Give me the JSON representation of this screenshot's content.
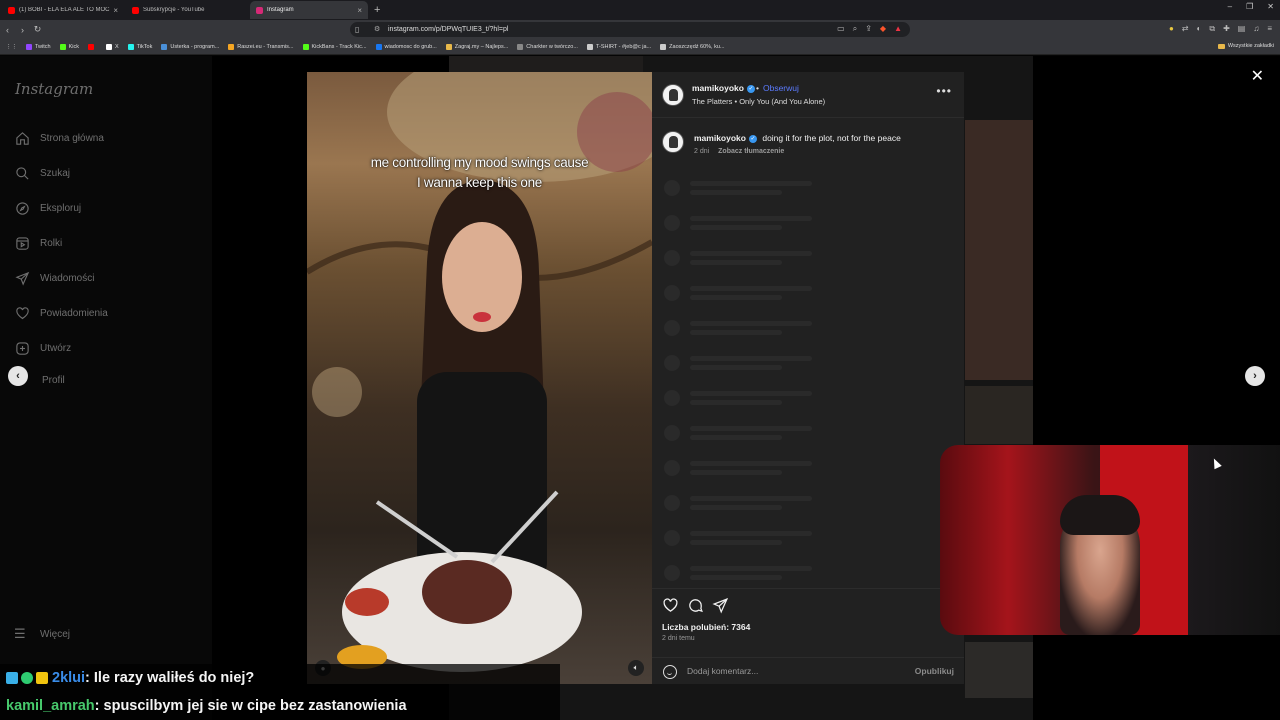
{
  "browser": {
    "tabs": [
      {
        "title": "(1) BOBI - ELA ELA ALE TO MOCNA",
        "color": "#ff0000"
      },
      {
        "title": "Subskrypcje - YouTube",
        "color": "#ff0000"
      },
      {
        "title": "Instagram",
        "color": "#d62976"
      }
    ],
    "new_tab": "+",
    "url": "instagram.com/p/DPWqTUIE3_t/?hl=pl",
    "bookmarks": [
      {
        "label": "Twitch",
        "color": "#9146ff"
      },
      {
        "label": "Kick",
        "color": "#53fc18"
      },
      {
        "label": "",
        "color": "#ff0000"
      },
      {
        "label": "X",
        "color": "#ffffff"
      },
      {
        "label": "TikTok",
        "color": "#25f4ee"
      },
      {
        "label": "Usterka - program...",
        "color": "#4a90d9"
      },
      {
        "label": "Raszei.eu - Transmis...",
        "color": "#f5a623"
      },
      {
        "label": "KickBans - Track Kic...",
        "color": "#53fc18"
      },
      {
        "label": "wiadomosc do grub...",
        "color": "#1877f2"
      },
      {
        "label": "Zagraj.my – Najleps...",
        "color": "#e8b84a"
      },
      {
        "label": "Charkter w twórczo...",
        "color": "#888888"
      },
      {
        "label": "T-SHIRT - #jeb@c ja...",
        "color": "#cccccc"
      },
      {
        "label": "Zaoszczędź 60%, ku...",
        "color": "#cccccc"
      }
    ],
    "bookmarks_all": "Wszystkie zakładki"
  },
  "sidebar": {
    "logo": "Instagram",
    "items": [
      {
        "label": "Strona główna",
        "icon": "home-icon"
      },
      {
        "label": "Szukaj",
        "icon": "search-icon"
      },
      {
        "label": "Eksploruj",
        "icon": "explore-icon"
      },
      {
        "label": "Rolki",
        "icon": "reels-icon"
      },
      {
        "label": "Wiadomości",
        "icon": "messages-icon"
      },
      {
        "label": "Powiadomienia",
        "icon": "heart-icon"
      },
      {
        "label": "Utwórz",
        "icon": "create-icon"
      },
      {
        "label": "Profil",
        "icon": "profile-icon"
      }
    ],
    "more": "Więcej"
  },
  "post": {
    "overlay_caption_line1": "me controlling my mood swings cause",
    "overlay_caption_line2": "I wanna keep this one",
    "username": "mamikoyoko",
    "follow": "Obserwuj",
    "dot": "•",
    "music": "The Platters • Only You (And You Alone)",
    "caption": "doing it for the plot, not for the peace",
    "caption_age": "2 dni",
    "translate": "Zobacz tłumaczenie",
    "likes": "Liczba polubień: 7364",
    "posted": "2 dni temu",
    "comment_placeholder": "Dodaj komentarz...",
    "publish": "Opublikuj",
    "more": "•••"
  },
  "chat": [
    {
      "user": "2klui",
      "message": ": Ile razy waliłeś do niej?"
    },
    {
      "user": "kamil_amrah",
      "message": ": spuscilbym jej sie w cipe bez zastanowienia"
    }
  ],
  "colors": {
    "accent": "#5b7bff",
    "verified": "#3897f0"
  }
}
